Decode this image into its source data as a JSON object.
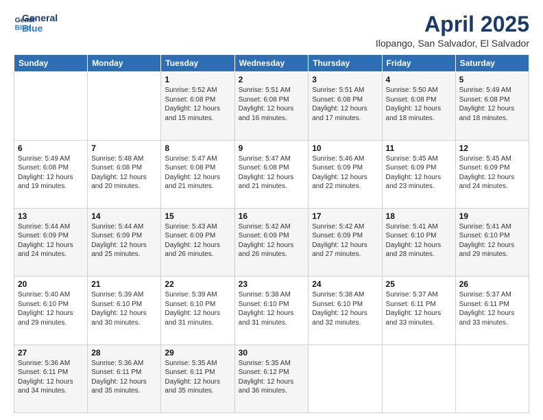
{
  "logo": {
    "line1": "General",
    "line2": "Blue"
  },
  "title": "April 2025",
  "subtitle": "Ilopango, San Salvador, El Salvador",
  "weekdays": [
    "Sunday",
    "Monday",
    "Tuesday",
    "Wednesday",
    "Thursday",
    "Friday",
    "Saturday"
  ],
  "weeks": [
    [
      {
        "day": "",
        "info": ""
      },
      {
        "day": "",
        "info": ""
      },
      {
        "day": "1",
        "info": "Sunrise: 5:52 AM\nSunset: 6:08 PM\nDaylight: 12 hours and 15 minutes."
      },
      {
        "day": "2",
        "info": "Sunrise: 5:51 AM\nSunset: 6:08 PM\nDaylight: 12 hours and 16 minutes."
      },
      {
        "day": "3",
        "info": "Sunrise: 5:51 AM\nSunset: 6:08 PM\nDaylight: 12 hours and 17 minutes."
      },
      {
        "day": "4",
        "info": "Sunrise: 5:50 AM\nSunset: 6:08 PM\nDaylight: 12 hours and 18 minutes."
      },
      {
        "day": "5",
        "info": "Sunrise: 5:49 AM\nSunset: 6:08 PM\nDaylight: 12 hours and 18 minutes."
      }
    ],
    [
      {
        "day": "6",
        "info": "Sunrise: 5:49 AM\nSunset: 6:08 PM\nDaylight: 12 hours and 19 minutes."
      },
      {
        "day": "7",
        "info": "Sunrise: 5:48 AM\nSunset: 6:08 PM\nDaylight: 12 hours and 20 minutes."
      },
      {
        "day": "8",
        "info": "Sunrise: 5:47 AM\nSunset: 6:08 PM\nDaylight: 12 hours and 21 minutes."
      },
      {
        "day": "9",
        "info": "Sunrise: 5:47 AM\nSunset: 6:08 PM\nDaylight: 12 hours and 21 minutes."
      },
      {
        "day": "10",
        "info": "Sunrise: 5:46 AM\nSunset: 6:09 PM\nDaylight: 12 hours and 22 minutes."
      },
      {
        "day": "11",
        "info": "Sunrise: 5:45 AM\nSunset: 6:09 PM\nDaylight: 12 hours and 23 minutes."
      },
      {
        "day": "12",
        "info": "Sunrise: 5:45 AM\nSunset: 6:09 PM\nDaylight: 12 hours and 24 minutes."
      }
    ],
    [
      {
        "day": "13",
        "info": "Sunrise: 5:44 AM\nSunset: 6:09 PM\nDaylight: 12 hours and 24 minutes."
      },
      {
        "day": "14",
        "info": "Sunrise: 5:44 AM\nSunset: 6:09 PM\nDaylight: 12 hours and 25 minutes."
      },
      {
        "day": "15",
        "info": "Sunrise: 5:43 AM\nSunset: 6:09 PM\nDaylight: 12 hours and 26 minutes."
      },
      {
        "day": "16",
        "info": "Sunrise: 5:42 AM\nSunset: 6:09 PM\nDaylight: 12 hours and 26 minutes."
      },
      {
        "day": "17",
        "info": "Sunrise: 5:42 AM\nSunset: 6:09 PM\nDaylight: 12 hours and 27 minutes."
      },
      {
        "day": "18",
        "info": "Sunrise: 5:41 AM\nSunset: 6:10 PM\nDaylight: 12 hours and 28 minutes."
      },
      {
        "day": "19",
        "info": "Sunrise: 5:41 AM\nSunset: 6:10 PM\nDaylight: 12 hours and 29 minutes."
      }
    ],
    [
      {
        "day": "20",
        "info": "Sunrise: 5:40 AM\nSunset: 6:10 PM\nDaylight: 12 hours and 29 minutes."
      },
      {
        "day": "21",
        "info": "Sunrise: 5:39 AM\nSunset: 6:10 PM\nDaylight: 12 hours and 30 minutes."
      },
      {
        "day": "22",
        "info": "Sunrise: 5:39 AM\nSunset: 6:10 PM\nDaylight: 12 hours and 31 minutes."
      },
      {
        "day": "23",
        "info": "Sunrise: 5:38 AM\nSunset: 6:10 PM\nDaylight: 12 hours and 31 minutes."
      },
      {
        "day": "24",
        "info": "Sunrise: 5:38 AM\nSunset: 6:10 PM\nDaylight: 12 hours and 32 minutes."
      },
      {
        "day": "25",
        "info": "Sunrise: 5:37 AM\nSunset: 6:11 PM\nDaylight: 12 hours and 33 minutes."
      },
      {
        "day": "26",
        "info": "Sunrise: 5:37 AM\nSunset: 6:11 PM\nDaylight: 12 hours and 33 minutes."
      }
    ],
    [
      {
        "day": "27",
        "info": "Sunrise: 5:36 AM\nSunset: 6:11 PM\nDaylight: 12 hours and 34 minutes."
      },
      {
        "day": "28",
        "info": "Sunrise: 5:36 AM\nSunset: 6:11 PM\nDaylight: 12 hours and 35 minutes."
      },
      {
        "day": "29",
        "info": "Sunrise: 5:35 AM\nSunset: 6:11 PM\nDaylight: 12 hours and 35 minutes."
      },
      {
        "day": "30",
        "info": "Sunrise: 5:35 AM\nSunset: 6:12 PM\nDaylight: 12 hours and 36 minutes."
      },
      {
        "day": "",
        "info": ""
      },
      {
        "day": "",
        "info": ""
      },
      {
        "day": "",
        "info": ""
      }
    ]
  ]
}
